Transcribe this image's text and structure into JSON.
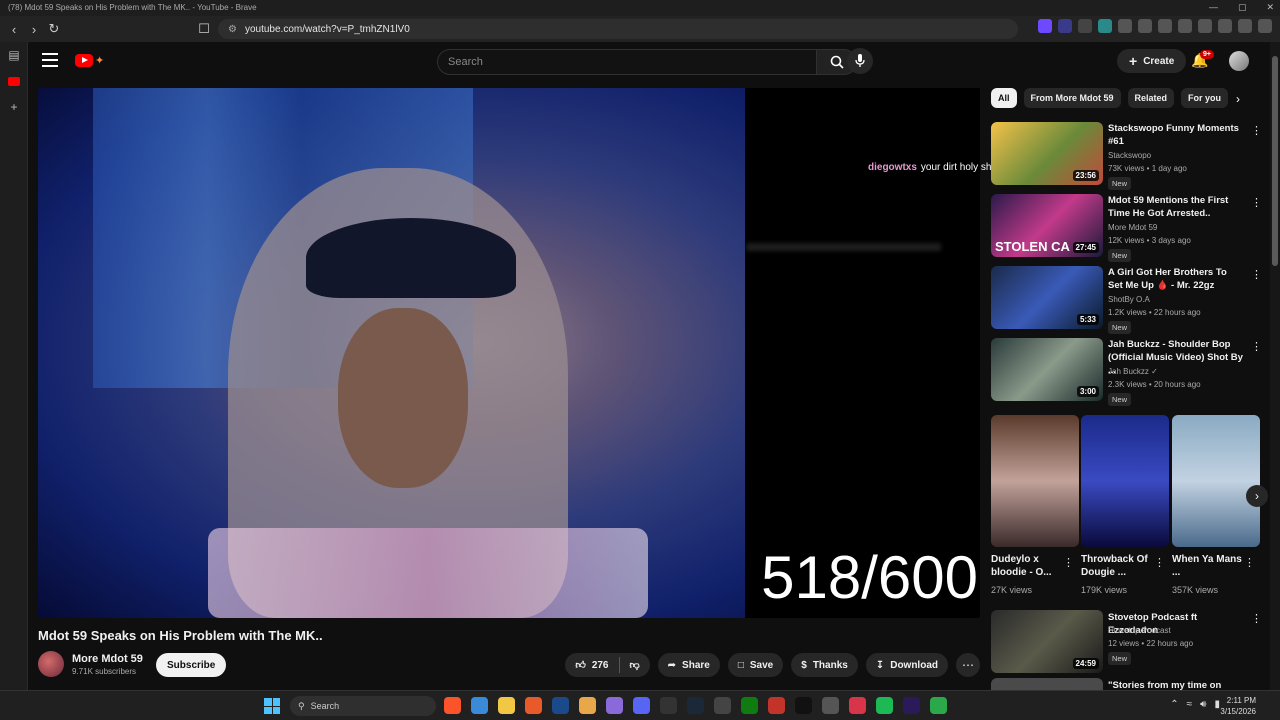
{
  "window": {
    "title": "(78) Mdot 59 Speaks on His Problem with The MK.. - YouTube - Brave",
    "ctrls": [
      "—",
      "▢",
      "✕"
    ]
  },
  "browser": {
    "url": "youtube.com/watch?v=P_tmhZN1lV0"
  },
  "header": {
    "search_placeholder": "Search",
    "create_label": "Create",
    "notif_count": "9+"
  },
  "video": {
    "title": "Mdot 59 Speaks on His Problem with The MK..",
    "overlay_counter": "518/600",
    "chat": {
      "user": "diegowtxs",
      "message": "your dirt holy shit"
    }
  },
  "channel": {
    "name": "More Mdot 59",
    "subs": "9.71K subscribers",
    "subscribe_label": "Subscribe"
  },
  "actions": {
    "likes": "276",
    "share": "Share",
    "save": "Save",
    "thanks": "Thanks",
    "download": "Download"
  },
  "chips": [
    "All",
    "From More Mdot 59",
    "Related",
    "For you"
  ],
  "recs": [
    {
      "title": "Stackswopo Funny Moments #61",
      "channel": "Stackswopo",
      "meta": "73K views • 1 day ago",
      "badge": "New",
      "duration": "23:56"
    },
    {
      "title": "Mdot 59 Mentions the First Time He Got Arrested..",
      "channel": "More Mdot 59",
      "meta": "12K views • 3 days ago",
      "badge": "New",
      "duration": "27:45",
      "thumb_text": "STOLEN CA"
    },
    {
      "title": "A Girl Got Her Brothers To Set Me Up 🩸 - Mr. 22gz",
      "channel": "ShotBy O.A",
      "meta": "1.2K views • 22 hours ago",
      "badge": "New",
      "duration": "5:33"
    },
    {
      "title": "Jah Buckzz  - Shoulder Bop (Official Music Video) Shot By ...",
      "channel": "Jah Buckzz ✓",
      "meta": "2.3K views • 20 hours ago",
      "badge": "New",
      "duration": "3:00"
    },
    {
      "title": "Stovetop Podcast ft Ezzodadon",
      "channel": "Stovetop Podcast",
      "meta": "12 views • 22 hours ago",
      "badge": "New",
      "duration": "24:59"
    },
    {
      "title": "\"Stories from my time on Riker's"
    }
  ],
  "shorts": [
    {
      "title": "Dudeylo x bloodie - O...",
      "views": "27K views"
    },
    {
      "title": "Throwback Of Dougie ...",
      "views": "179K views"
    },
    {
      "title": "When Ya Mans ...",
      "views": "357K views"
    }
  ],
  "taskbar": {
    "search_label": "Search",
    "time": "2:11 PM",
    "date": "3/15/2026"
  },
  "colors": {
    "accent": "#ff0000",
    "background": "#0f0f0f",
    "chip": "#272727",
    "chat_user": "#e79ad1"
  }
}
